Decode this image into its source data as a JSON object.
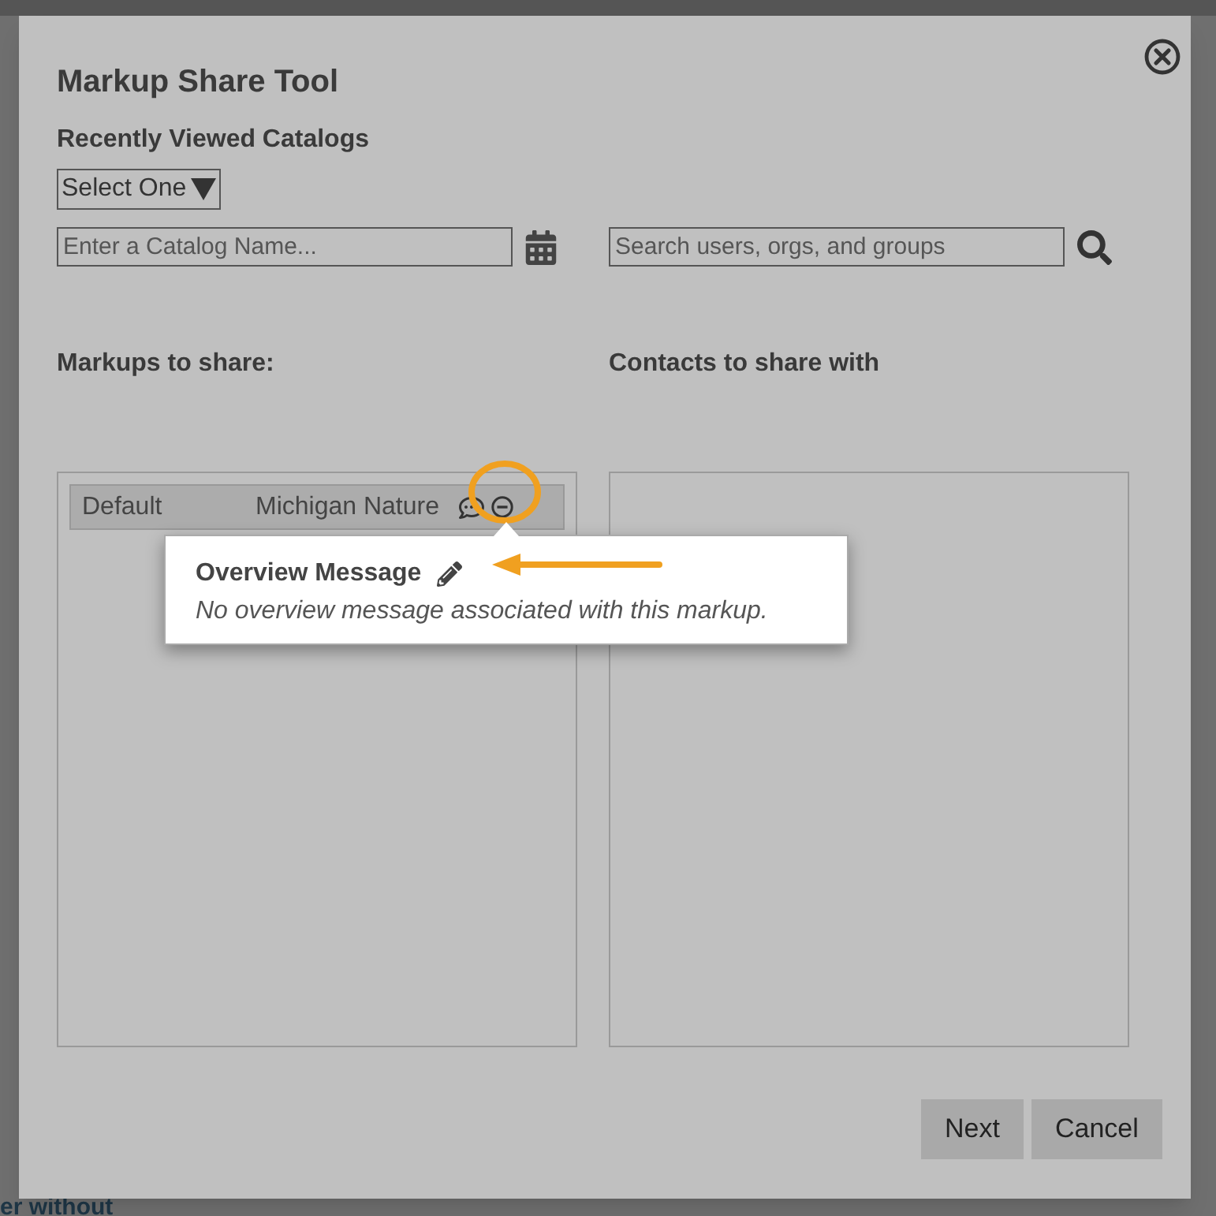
{
  "background": {
    "bottom_text": "er without"
  },
  "dialog": {
    "title": "Markup Share Tool",
    "recent_label": "Recently Viewed Catalogs",
    "recent_select": "Select One",
    "catalog_field": {
      "placeholder": "Enter a Catalog Name..."
    },
    "contacts_search": {
      "placeholder": "Search users, orgs, and groups"
    },
    "markups_heading": "Markups to share:",
    "contacts_heading": "Contacts to share with",
    "markups": [
      {
        "name": "Default",
        "catalog": "Michigan Nature",
        "selected": true
      }
    ],
    "tooltip": {
      "title": "Overview Message",
      "message": "No overview message associated with this markup."
    },
    "buttons": [
      "Next",
      "Cancel"
    ]
  }
}
